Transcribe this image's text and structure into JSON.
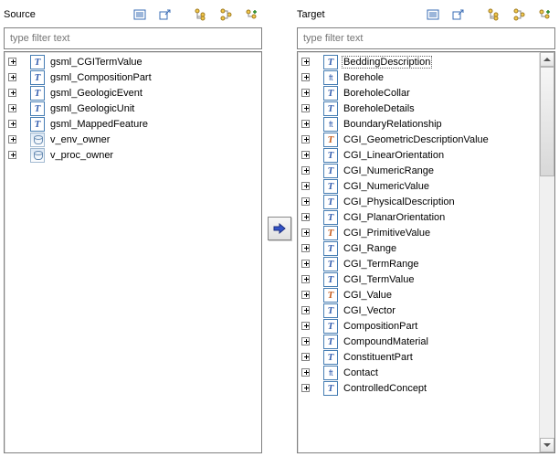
{
  "source": {
    "title": "Source",
    "filter_placeholder": "type filter text",
    "items": [
      {
        "icon": "T",
        "label": "gsml_CGITermValue"
      },
      {
        "icon": "T",
        "label": "gsml_CompositionPart"
      },
      {
        "icon": "T",
        "label": "gsml_GeologicEvent"
      },
      {
        "icon": "T",
        "label": "gsml_GeologicUnit"
      },
      {
        "icon": "T",
        "label": "gsml_MappedFeature"
      },
      {
        "icon": "db",
        "label": "v_env_owner"
      },
      {
        "icon": "db",
        "label": "v_proc_owner"
      }
    ]
  },
  "target": {
    "title": "Target",
    "filter_placeholder": "type filter text",
    "selected_label": "BeddingDescription",
    "items": [
      {
        "icon": "T",
        "label": "BeddingDescription",
        "selected": true
      },
      {
        "icon": "ft",
        "label": "Borehole"
      },
      {
        "icon": "T",
        "label": "BoreholeCollar"
      },
      {
        "icon": "T",
        "label": "BoreholeDetails"
      },
      {
        "icon": "ft",
        "label": "BoundaryRelationship"
      },
      {
        "icon": "Ti",
        "label": "CGI_GeometricDescriptionValue"
      },
      {
        "icon": "T",
        "label": "CGI_LinearOrientation"
      },
      {
        "icon": "T",
        "label": "CGI_NumericRange"
      },
      {
        "icon": "T",
        "label": "CGI_NumericValue"
      },
      {
        "icon": "T",
        "label": "CGI_PhysicalDescription"
      },
      {
        "icon": "T",
        "label": "CGI_PlanarOrientation"
      },
      {
        "icon": "Ti",
        "label": "CGI_PrimitiveValue"
      },
      {
        "icon": "T",
        "label": "CGI_Range"
      },
      {
        "icon": "T",
        "label": "CGI_TermRange"
      },
      {
        "icon": "T",
        "label": "CGI_TermValue"
      },
      {
        "icon": "Ti",
        "label": "CGI_Value"
      },
      {
        "icon": "T",
        "label": "CGI_Vector"
      },
      {
        "icon": "T",
        "label": "CompositionPart"
      },
      {
        "icon": "T",
        "label": "CompoundMaterial"
      },
      {
        "icon": "T",
        "label": "ConstituentPart"
      },
      {
        "icon": "ft",
        "label": "Contact"
      },
      {
        "icon": "T",
        "label": "ControlledConcept"
      }
    ]
  },
  "toolbar": {
    "btn1": "list-view",
    "btn2": "link-open",
    "btn3": "tree-view",
    "btn4": "tree-compact",
    "btn5": "tree-add"
  }
}
